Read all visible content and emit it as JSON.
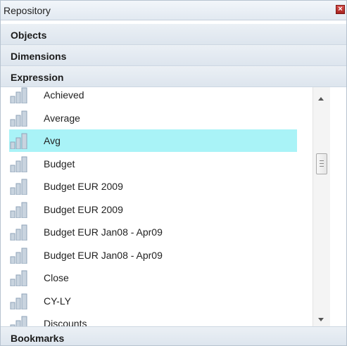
{
  "window": {
    "title": "Repository",
    "close_glyph": "×"
  },
  "sections": {
    "objects": "Objects",
    "dimensions": "Dimensions",
    "expression": "Expression",
    "bookmarks": "Bookmarks"
  },
  "expression_list": {
    "icon": "bar-chart-icon",
    "selected_index": 2,
    "selected_color": "#a9f3f7",
    "items": [
      "Achieved",
      "Average",
      "Avg",
      "Budget",
      "Budget EUR 2009",
      "Budget EUR 2009",
      "Budget EUR Jan08 - Apr09",
      "Budget EUR Jan08 - Apr09",
      "Close",
      "CY-LY",
      "Discounts"
    ]
  }
}
